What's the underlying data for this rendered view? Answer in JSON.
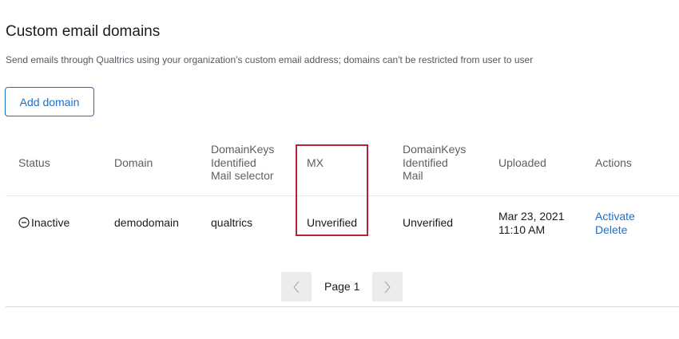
{
  "header": {
    "title": "Custom email domains",
    "subtitle": "Send emails through Qualtrics using your organization's custom email address; domains can't be restricted from user to user"
  },
  "toolbar": {
    "add_label": "Add domain"
  },
  "table": {
    "columns": {
      "status": "Status",
      "domain": "Domain",
      "dkim_selector": [
        "DomainKeys",
        "Identified",
        "Mail selector"
      ],
      "mx": "MX",
      "dkim": [
        "DomainKeys",
        "Identified",
        "Mail"
      ],
      "uploaded": "Uploaded",
      "actions": "Actions"
    },
    "rows": [
      {
        "status": "Inactive",
        "status_icon": "minus-circle-icon",
        "domain": "demodomain",
        "dkim_selector": "qualtrics",
        "mx": "Unverified",
        "dkim": "Unverified",
        "uploaded_date": "Mar 23, 2021",
        "uploaded_time": "11:10 AM",
        "actions": [
          "Activate",
          "Delete"
        ]
      }
    ]
  },
  "pagination": {
    "label": "Page 1",
    "prev_icon": "chevron-left-icon",
    "next_icon": "chevron-right-icon"
  },
  "colors": {
    "accent": "#1f6fc5",
    "highlight": "#b32535",
    "pager_bg": "#ececec"
  }
}
